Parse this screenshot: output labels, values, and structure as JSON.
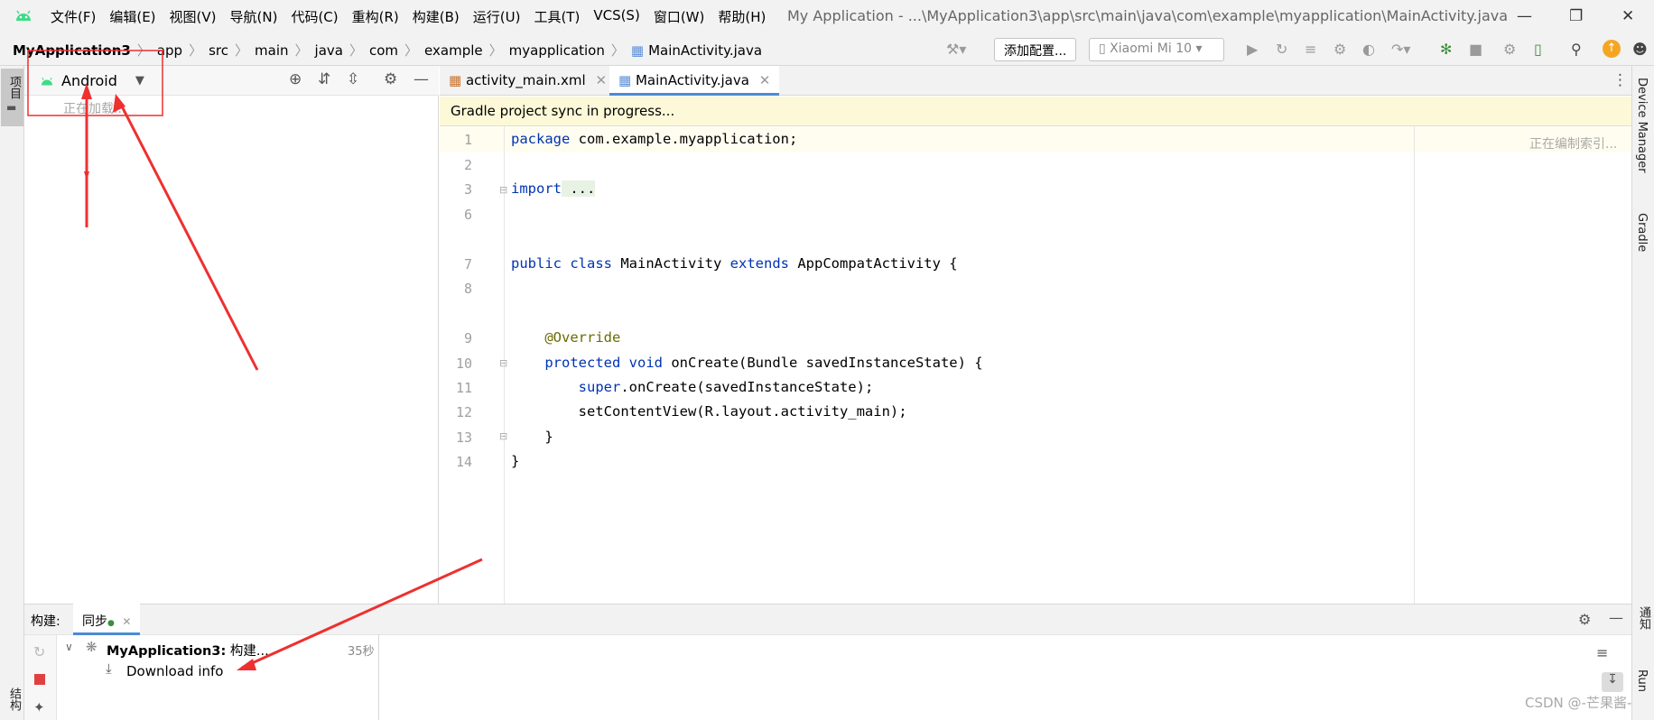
{
  "menu": [
    "文件(F)",
    "编辑(E)",
    "视图(V)",
    "导航(N)",
    "代码(C)",
    "重构(R)",
    "构建(B)",
    "运行(U)",
    "工具(T)",
    "VCS(S)",
    "窗口(W)",
    "帮助(H)"
  ],
  "window_title": "My Application - ...\\MyApplication3\\app\\src\\main\\java\\com\\example\\myapplication\\MainActivity.java",
  "breadcrumbs": [
    "MyApplication3",
    "app",
    "src",
    "main",
    "java",
    "com",
    "example",
    "myapplication",
    "MainActivity.java"
  ],
  "toolbar": {
    "add_config": "添加配置...",
    "device": "Xiaomi Mi 10"
  },
  "project": {
    "view_mode": "Android",
    "loading": "正在加载..."
  },
  "left_strip": {
    "project_label": "项目",
    "structure_label": "结构"
  },
  "tabs": [
    {
      "label": "activity_main.xml"
    },
    {
      "label": "MainActivity.java"
    }
  ],
  "banner": "Gradle project sync in progress...",
  "indexing": "正在编制索引...",
  "line_numbers": [
    "1",
    "2",
    "3",
    "6",
    "7",
    "8",
    "9",
    "10",
    "11",
    "12",
    "13",
    "14"
  ],
  "code": {
    "l1_kw": "package",
    "l1_rest": " com.example.myapplication;",
    "l3_kw": "import",
    "l3_rest": " ...",
    "l7_kw1": "public",
    "l7_kw2": "class",
    "l7_name": " MainActivity ",
    "l7_kw3": "extends",
    "l7_rest": " AppCompatActivity {",
    "l9": "    @Override",
    "l10_kw1": "protected",
    "l10_kw2": "void",
    "l10_rest": " onCreate(Bundle savedInstanceState) {",
    "l11_kw": "super",
    "l11_rest": ".onCreate(savedInstanceState);",
    "l12": "        setContentView(R.layout.activity_main);",
    "l13": "    }",
    "l14": "}"
  },
  "right_strip": {
    "device_manager": "Device Manager",
    "gradle": "Gradle",
    "notifications": "通知",
    "run": "Run"
  },
  "build": {
    "label": "构建:",
    "tab": "同步",
    "project": "MyApplication3:",
    "status": "构建...",
    "time": "35秒",
    "item": "Download info"
  },
  "watermark": "CSDN @-芒果酱-",
  "colors": {
    "android_green": "#3ddc84",
    "keyword": "#0033b3",
    "annotation_red": "#ee3030",
    "banner_bg": "#fdf8d7"
  }
}
